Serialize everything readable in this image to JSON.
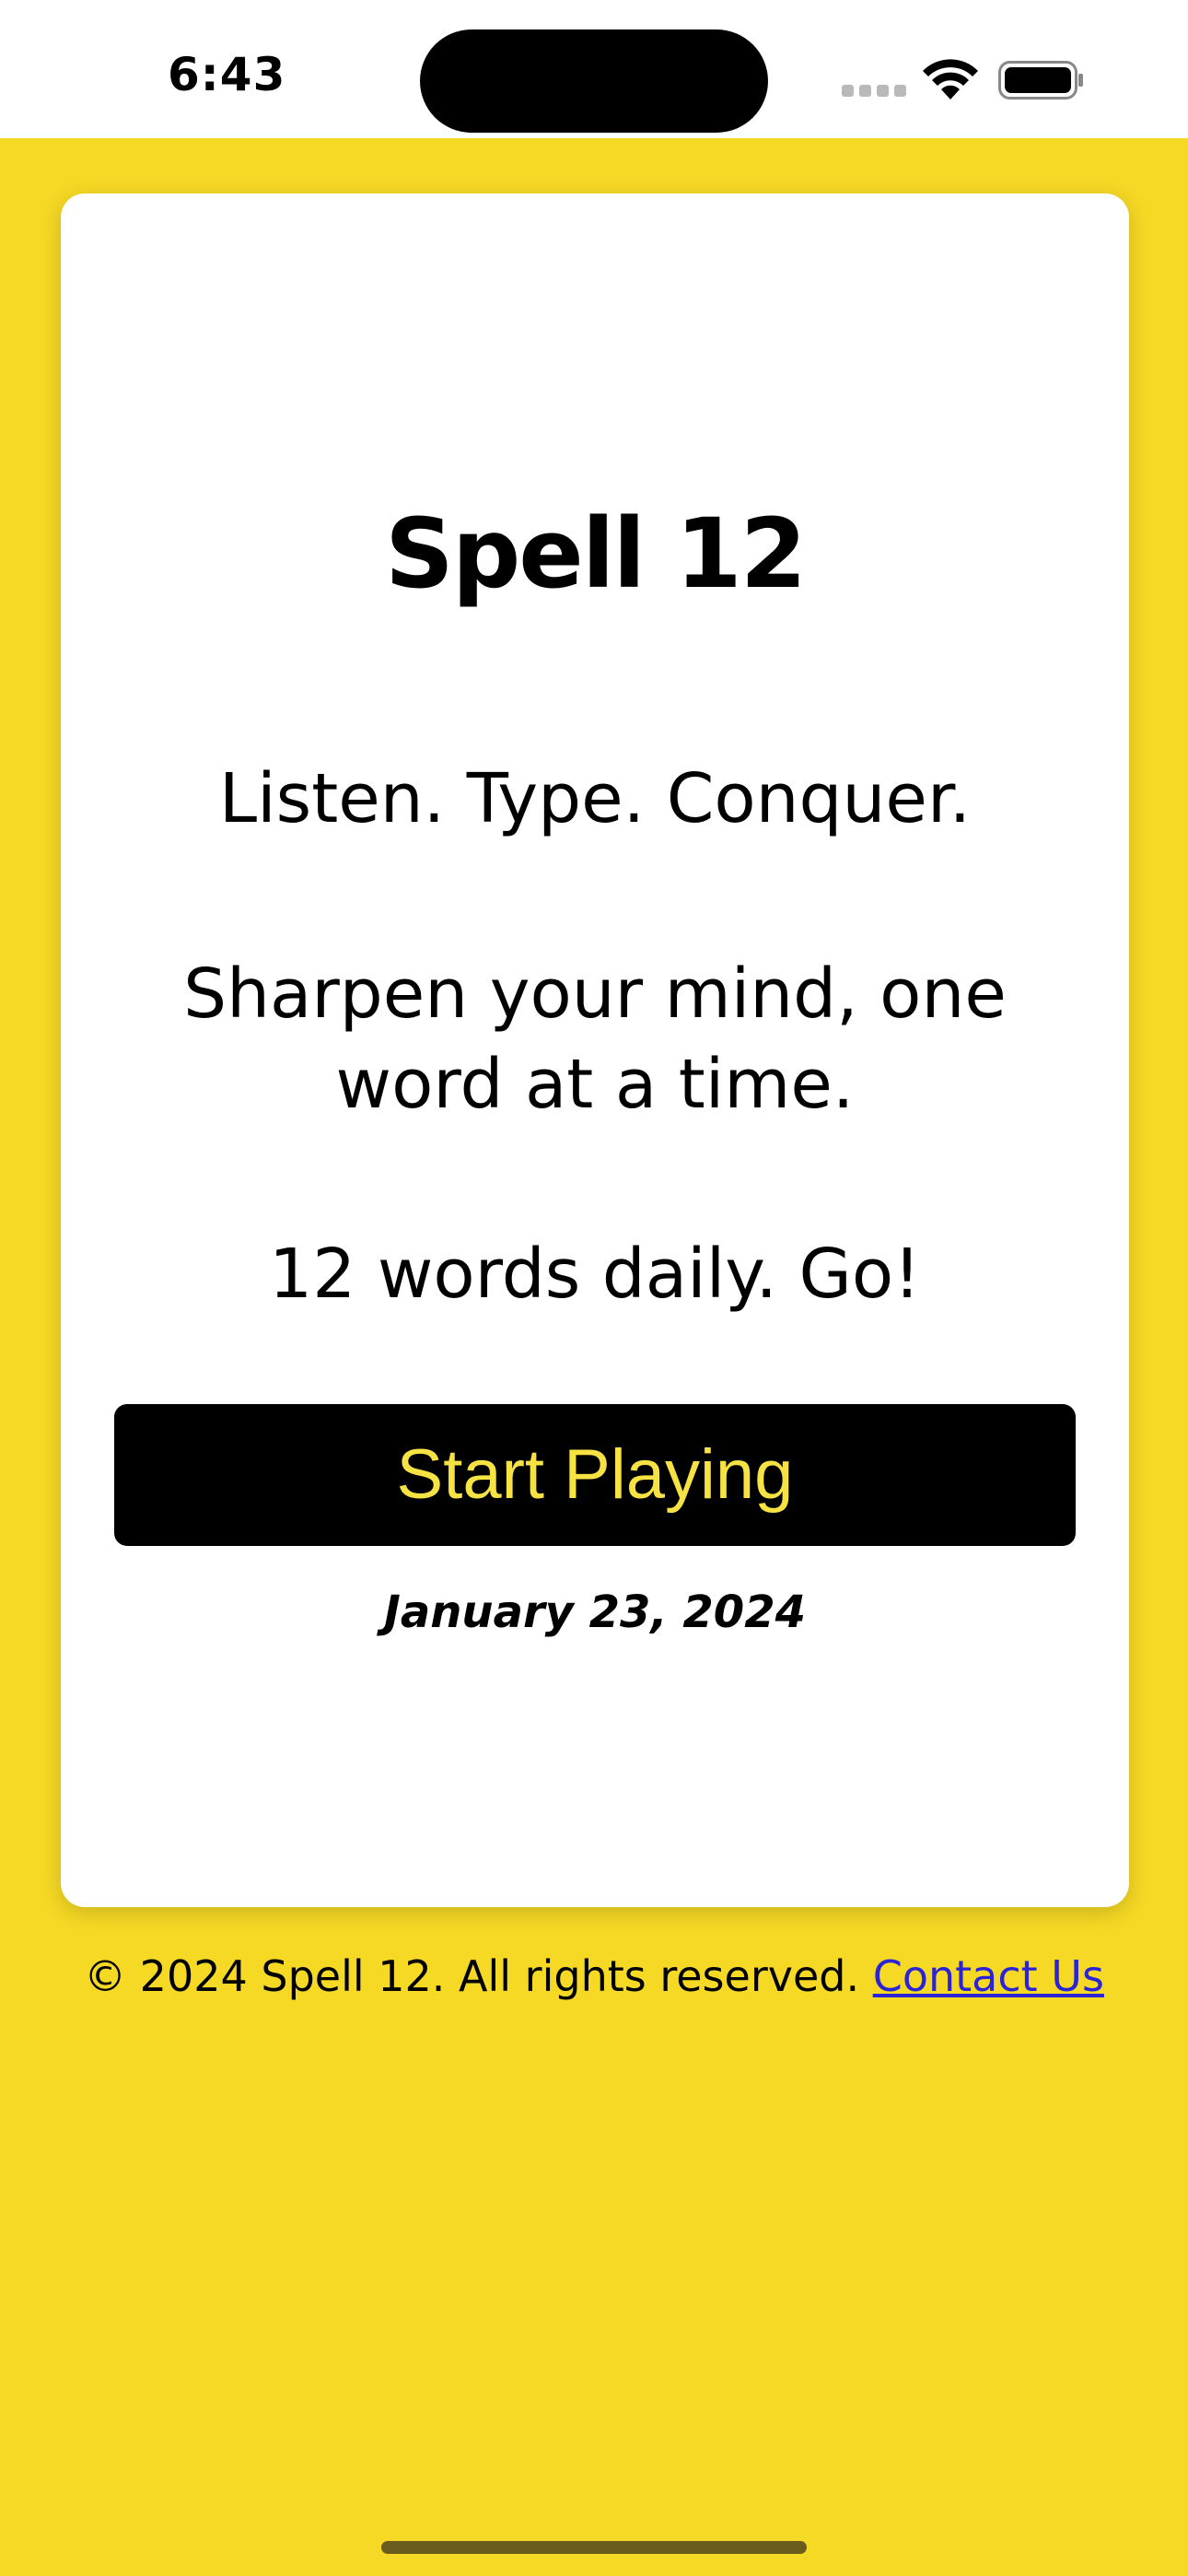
{
  "status_bar": {
    "time": "6:43"
  },
  "main": {
    "title": "Spell 12",
    "tagline": "Listen. Type. Conquer.",
    "subtitle": "Sharpen your mind, one word at a time.",
    "daily_text": "12 words daily. Go!",
    "start_button_label": "Start Playing",
    "date": "January 23, 2024"
  },
  "footer": {
    "copyright": "© 2024 Spell 12. All rights reserved.",
    "contact_link": "Contact Us"
  },
  "colors": {
    "background": "#f6d924",
    "card": "#ffffff",
    "button_bg": "#000000",
    "button_text": "#f6e243",
    "link": "#2a24d6"
  },
  "icons": {
    "signal": "signal-icon",
    "wifi": "wifi-icon",
    "battery": "battery-icon"
  }
}
